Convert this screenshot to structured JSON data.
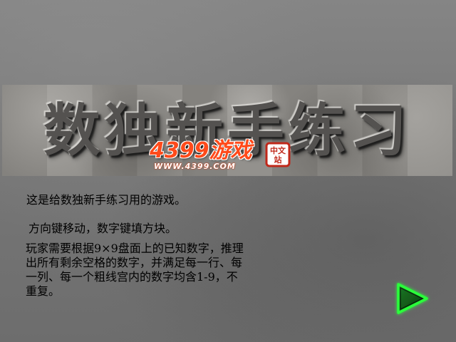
{
  "title": "数独新手练习",
  "logo": {
    "brand": "4399游戏",
    "url": "WWW.4399.COM",
    "seal_text": "中文站",
    "brand_color": "#ff4a1a"
  },
  "intro": {
    "line1": "这是给数独新手练习用的游戏。",
    "line2": "方向键移动，数字键填方块。",
    "rules": "玩家需要根据9×9盘面上的已知数字，推理\n出所有剩余空格的数字，并满足每一行、每\n一列、每一个粗线宫内的数字均含1-9，不\n重复。"
  },
  "next_button": {
    "icon": "play-arrow-icon",
    "arrow_color": "#0a4d12",
    "glow_color": "#2aff3a"
  }
}
